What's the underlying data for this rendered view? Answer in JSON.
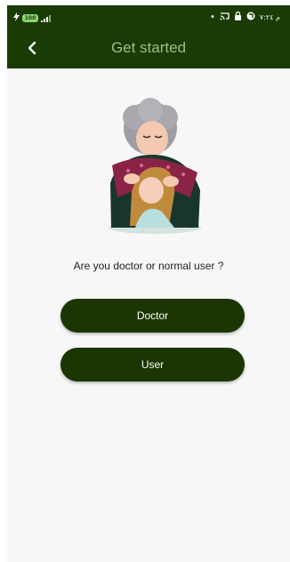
{
  "colors": {
    "primary": "#1b3b05",
    "title_text": "#a4ba8b",
    "button": "#1b3603",
    "background": "#f8f7f8"
  },
  "status_bar": {
    "battery_level": "100",
    "right_text": "م ٧:٢٤",
    "icons": [
      "lightning-icon",
      "battery-icon",
      "signal-icon",
      "dot-icon",
      "cast-icon",
      "lock-icon",
      "shield-icon"
    ]
  },
  "appbar": {
    "title": "Get started",
    "back_icon": "chevron-left-icon"
  },
  "illustration": {
    "icon": "grandmother-hugging-child-illustration"
  },
  "main": {
    "question": "Are you doctor or normal user ?",
    "doctor_button": "Doctor",
    "user_button": "User"
  }
}
